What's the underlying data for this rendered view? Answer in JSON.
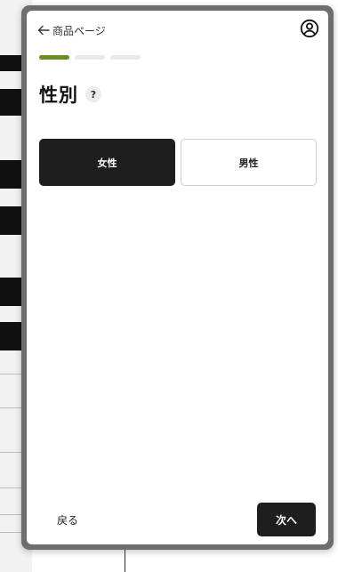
{
  "header": {
    "back_label": "商品ページ",
    "account_icon": "account-circle-icon"
  },
  "progress": {
    "total_steps": 3,
    "current_step": 1,
    "active_color": "#6b8e23",
    "inactive_color": "#e9e9e9"
  },
  "question": {
    "title": "性別",
    "help_label": "?"
  },
  "options": [
    {
      "label": "女性",
      "selected": true
    },
    {
      "label": "男性",
      "selected": false
    }
  ],
  "footer": {
    "back_label": "戻る",
    "next_label": "次へ"
  }
}
